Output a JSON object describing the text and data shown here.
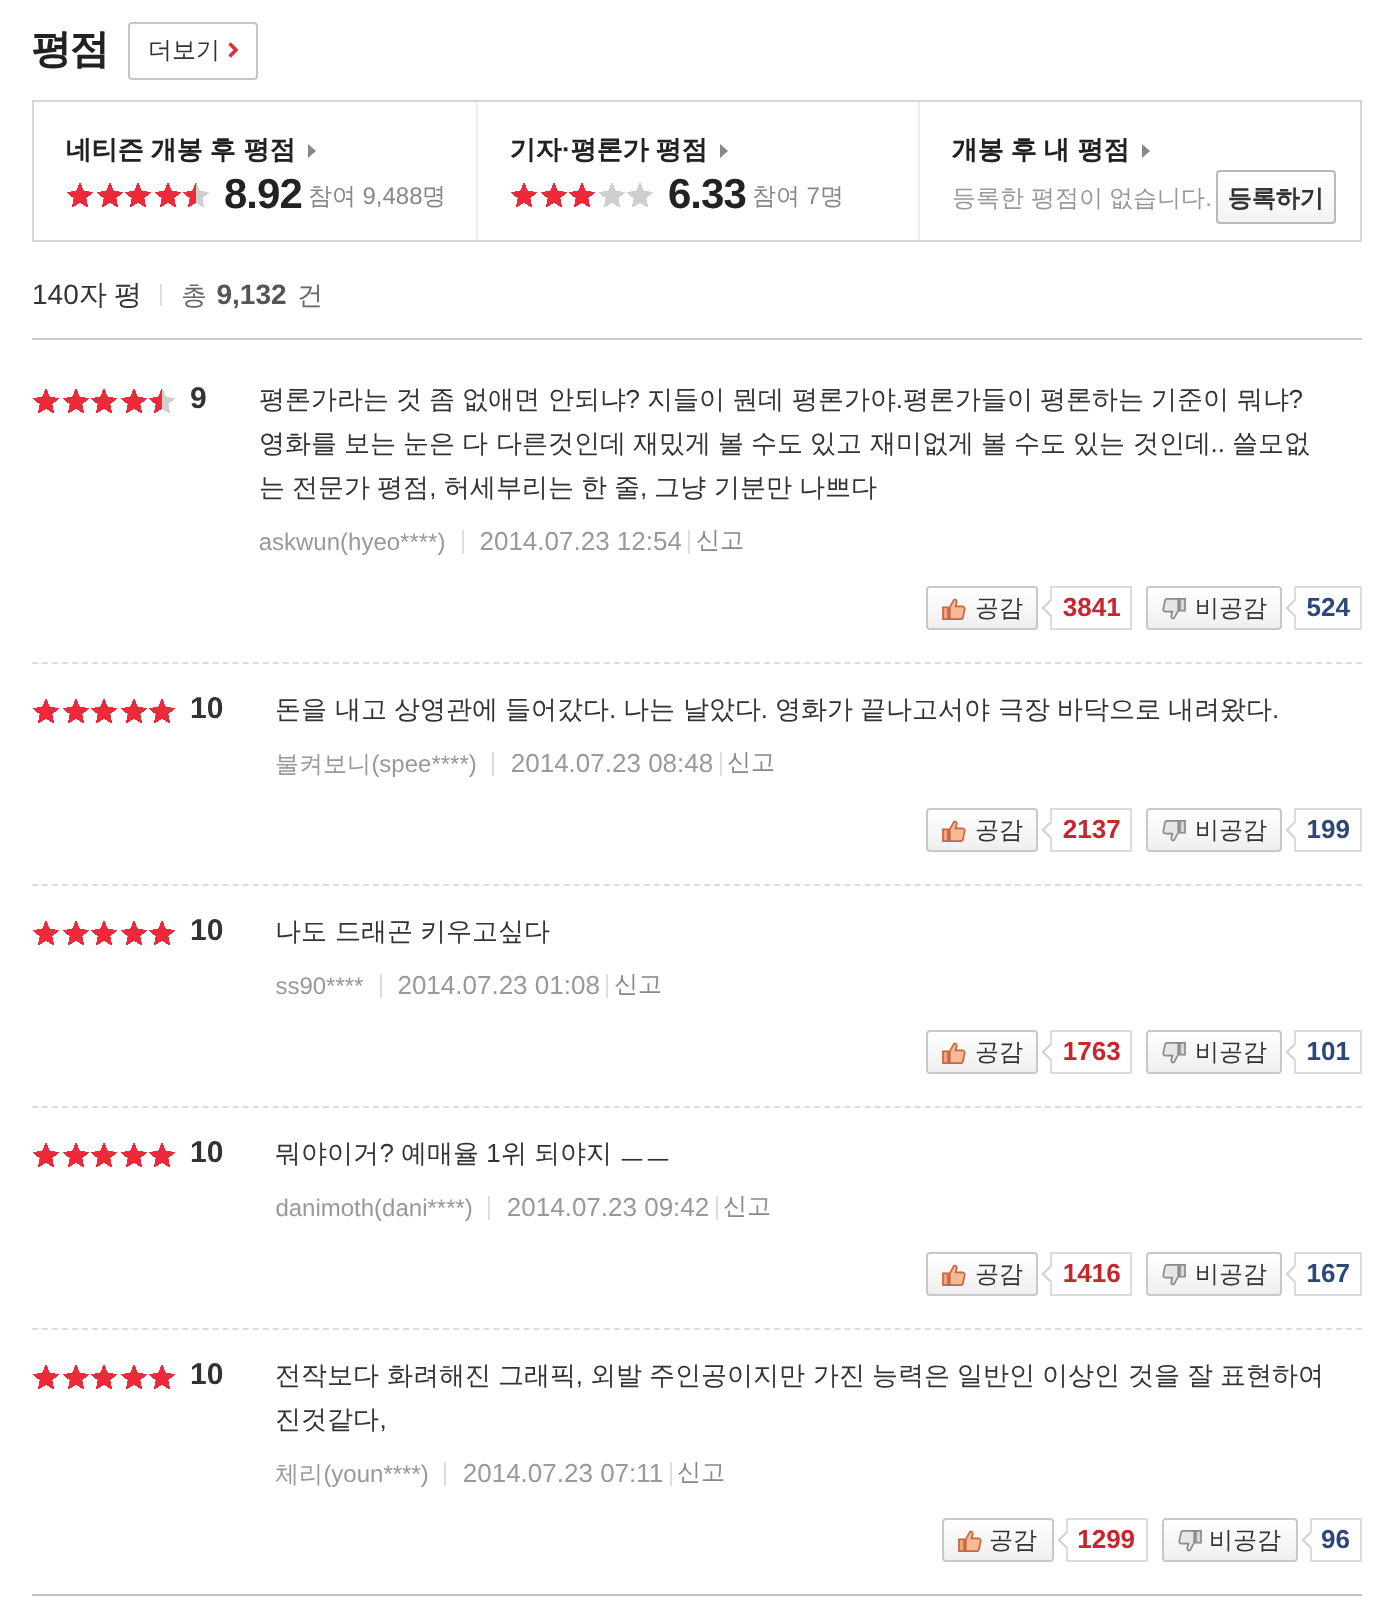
{
  "header": {
    "title": "평점",
    "more_button": "더보기"
  },
  "summary": [
    {
      "kind": "score",
      "title": "네티즌 개봉 후 평점",
      "stars": 4.5,
      "score": "8.92",
      "participants": "참여 9,488명"
    },
    {
      "kind": "score",
      "title": "기자·평론가 평점",
      "stars": 3,
      "score": "6.33",
      "participants": "참여 7명"
    },
    {
      "kind": "mine",
      "title": "개봉 후 내 평점",
      "message": "등록한 평점이 없습니다.",
      "button": "등록하기"
    }
  ],
  "list_header": {
    "title": "140자 평",
    "total_label": "총",
    "total": "9,132",
    "unit": "건"
  },
  "reviews": [
    {
      "stars": 4.5,
      "score": "9",
      "text": "평론가라는 것 좀 없애면 안되냐? 지들이 뭔데 평론가야.평론가들이 평론하는 기준이 뭐냐? 영화를 보는 눈은 다 다른것인데 재밌게 볼 수도 있고 재미없게 볼 수도 있는 것인데.. 쓸모없는 전문가 평점, 허세부리는 한 줄, 그냥 기분만 나쁘다",
      "author": "askwun(hyeo****)",
      "date": "2014.07.23 12:54",
      "report": "신고",
      "like_label": "공감",
      "likes": "3841",
      "dislike_label": "비공감",
      "dislikes": "524"
    },
    {
      "stars": 5,
      "score": "10",
      "text": "돈을 내고 상영관에 들어갔다. 나는 날았다. 영화가 끝나고서야 극장 바닥으로 내려왔다.",
      "author": "불켜보니(spee****)",
      "date": "2014.07.23 08:48",
      "report": "신고",
      "like_label": "공감",
      "likes": "2137",
      "dislike_label": "비공감",
      "dislikes": "199"
    },
    {
      "stars": 5,
      "score": "10",
      "text": "나도 드래곤 키우고싶다",
      "author": "ss90****",
      "date": "2014.07.23 01:08",
      "report": "신고",
      "like_label": "공감",
      "likes": "1763",
      "dislike_label": "비공감",
      "dislikes": "101"
    },
    {
      "stars": 5,
      "score": "10",
      "text": "뭐야이거? 예매율 1위 되야지 ㅡㅡ",
      "author": "danimoth(dani****)",
      "date": "2014.07.23 09:42",
      "report": "신고",
      "like_label": "공감",
      "likes": "1416",
      "dislike_label": "비공감",
      "dislikes": "167"
    },
    {
      "stars": 5,
      "score": "10",
      "text": "전작보다 화려해진 그래픽, 외발 주인공이지만 가진 능력은 일반인 이상인 것을 잘 표현하여 진것같다,",
      "author": "체리(youn****)",
      "date": "2014.07.23 07:11",
      "report": "신고",
      "like_label": "공감",
      "likes": "1299",
      "dislike_label": "비공감",
      "dislikes": "96"
    }
  ]
}
